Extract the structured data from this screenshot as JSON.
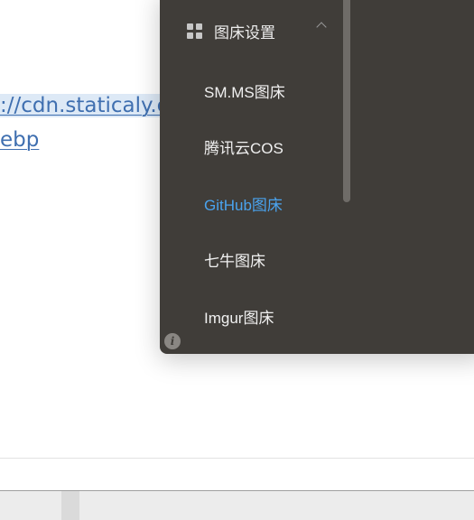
{
  "editor": {
    "link_line_1": "://cdn.staticaly.co",
    "link_line_2": "ebp"
  },
  "menu": {
    "header": {
      "icon": "grid-icon",
      "title": "图床设置",
      "expanded": true
    },
    "items": [
      {
        "label": "SM.MS图床",
        "active": false
      },
      {
        "label": "腾讯云COS",
        "active": false
      },
      {
        "label": "GitHub图床",
        "active": true
      },
      {
        "label": "七牛图床",
        "active": false
      },
      {
        "label": "Imgur图床",
        "active": false
      }
    ],
    "footer_icon": "info-icon"
  },
  "colors": {
    "panel_bg": "#403d39",
    "active_item": "#4aa3ee",
    "link": "#3f6fb0"
  }
}
